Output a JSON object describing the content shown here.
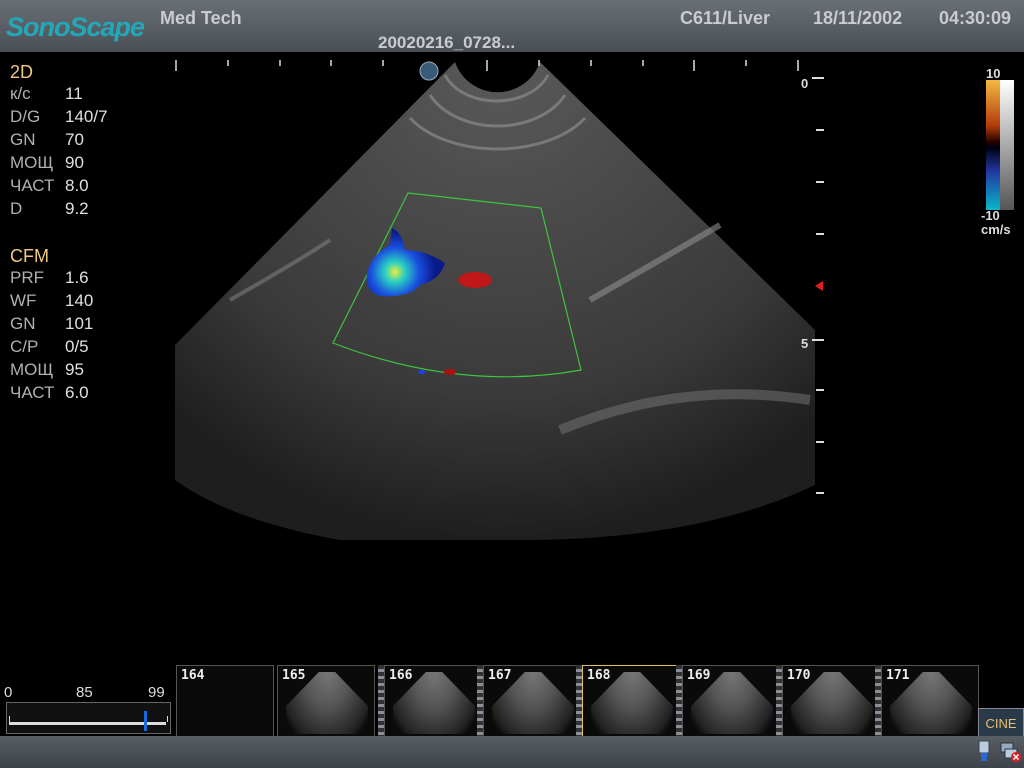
{
  "header": {
    "logo": "SonoScape",
    "institution": "Med Tech",
    "file_id": "20020216_0728...",
    "probe_preset": "C611/Liver",
    "date": "18/11/2002",
    "time": "04:30:09"
  },
  "mode_2d": {
    "title": "2D",
    "params": [
      {
        "k": "к/с",
        "v": "11"
      },
      {
        "k": "D/G",
        "v": "140/7"
      },
      {
        "k": "GN",
        "v": "70"
      },
      {
        "k": "МОЩ",
        "v": "90"
      },
      {
        "k": "ЧАСТ",
        "v": "8.0"
      },
      {
        "k": "D",
        "v": "9.2"
      }
    ]
  },
  "mode_cfm": {
    "title": "CFM",
    "params": [
      {
        "k": "PRF",
        "v": "1.6"
      },
      {
        "k": "WF",
        "v": "140"
      },
      {
        "k": "GN",
        "v": "101"
      },
      {
        "k": "C/P",
        "v": "0/5"
      },
      {
        "k": "МОЩ",
        "v": "95"
      },
      {
        "k": "ЧАСТ",
        "v": "6.0"
      }
    ]
  },
  "depth_scale": {
    "top": "0",
    "mid": "5"
  },
  "color_scale": {
    "max": "10",
    "min": "-10",
    "unit": "cm/s"
  },
  "cine": {
    "start": "0",
    "current": "85",
    "end": "99",
    "frames": [
      "164",
      "165",
      "166",
      "167",
      "168",
      "169",
      "170",
      "171"
    ],
    "selected_frame": "168",
    "button": "CINE"
  },
  "colors": {
    "accent": "#22a8b8",
    "label": "#f2c97f",
    "roi": "#3ec43e"
  }
}
